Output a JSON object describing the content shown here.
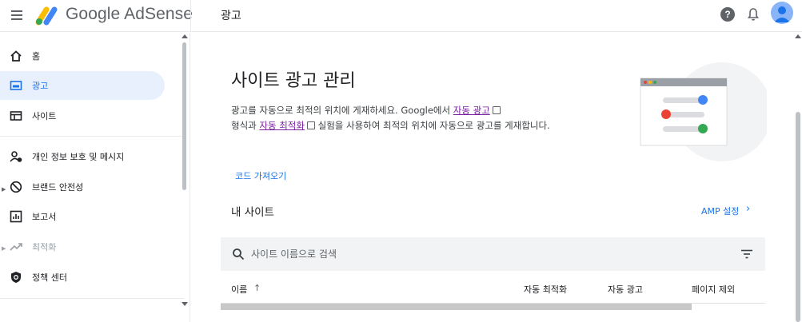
{
  "topbar": {
    "brand": "Google AdSense",
    "page_title": "광고",
    "help_glyph": "?"
  },
  "sidebar": {
    "items": [
      {
        "label": "홈",
        "icon": "home-icon"
      },
      {
        "label": "광고",
        "icon": "ads-icon",
        "active": true
      },
      {
        "label": "사이트",
        "icon": "sites-icon"
      },
      {
        "label": "개인 정보 보호 및 메시지",
        "icon": "privacy-messaging-icon"
      },
      {
        "label": "브랜드 안전성",
        "icon": "block-icon"
      },
      {
        "label": "보고서",
        "icon": "reports-icon"
      },
      {
        "label": "최적화",
        "icon": "trending-icon",
        "disabled": true
      },
      {
        "label": "정책 센터",
        "icon": "policy-shield-icon"
      }
    ]
  },
  "main": {
    "title": "사이트 광고 관리",
    "desc_part1": "광고를 자동으로 최적의 위치에 게재하세요. Google에서 ",
    "desc_link1": "자동 광고",
    "desc_part2": "형식과 ",
    "desc_link2": "자동 최적화",
    "desc_part3": " 실험을 사용하여 최적의 위치에 자동으로 광고를 게재합니다.",
    "import_button": "코드 가져오기",
    "my_sites": "내 사이트",
    "amp_settings": "AMP 설정",
    "amp_chevron": "›",
    "search_placeholder": "사이트 이름으로 검색",
    "table_headers": {
      "name": "이름",
      "sort_arrow": "↑",
      "auto_optimize": "자동 최적화",
      "auto_ads": "자동 광고",
      "page_exclusions": "페이지 제외"
    }
  },
  "colors": {
    "accent": "#1a73e8",
    "active_bg": "#e8f0fe",
    "link_visited": "#7b1fa2"
  }
}
